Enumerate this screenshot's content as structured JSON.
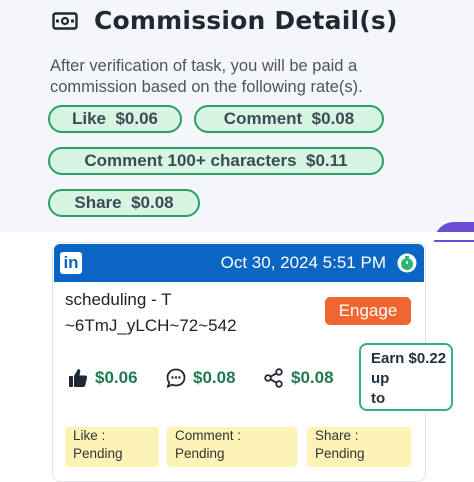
{
  "commission": {
    "title": "Commission Detail(s)",
    "icon": "money-icon",
    "description": "After verification of task, you will be paid a commission based on the following rate(s).",
    "rates": [
      {
        "label": "Like",
        "value": "$0.06"
      },
      {
        "label": "Comment",
        "value": "$0.08"
      },
      {
        "label": "Comment 100+ characters",
        "value": "$0.11"
      },
      {
        "label": "Share",
        "value": "$0.08"
      }
    ]
  },
  "task_card": {
    "platform_icon": "linkedin-icon",
    "platform_letters": "in",
    "date": "Oct 30, 2024 5:51 PM",
    "timer_icon": "timer-icon",
    "post_line1": "scheduling - T",
    "post_line2": "~6TmJ_yLCH~72~542",
    "engage_label": "Engage",
    "earn_line1": "Earn $0.22",
    "earn_line2": "up",
    "earn_line3": "to",
    "stats": {
      "like": "$0.06",
      "comment": "$0.08",
      "share": "$0.08"
    },
    "statuses": [
      {
        "label": "Like :",
        "state": "Pending"
      },
      {
        "label": "Comment :",
        "state": "Pending"
      },
      {
        "label": "Share :",
        "state": "Pending"
      }
    ]
  },
  "colors": {
    "pill_border": "#2e9e69",
    "pill_bg": "#d6f5e3",
    "linkedin_blue": "#0a66c2",
    "engage_orange": "#f06630",
    "status_bg": "#fdf3b6"
  }
}
